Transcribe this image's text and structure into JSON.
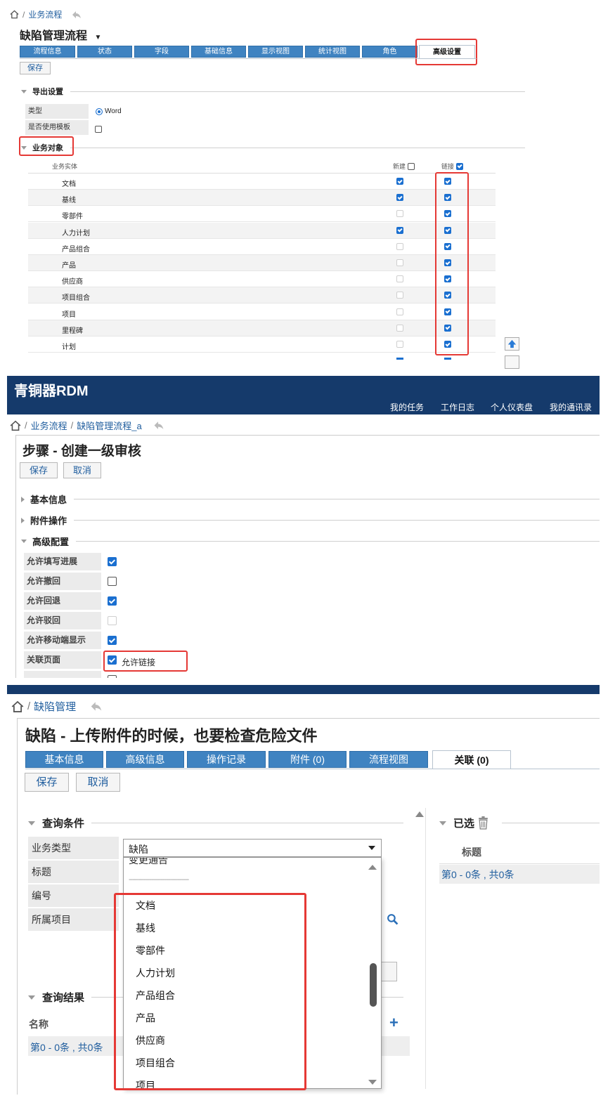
{
  "panel1": {
    "breadcrumb": [
      "业务流程"
    ],
    "title": "缺陷管理流程",
    "tabs": [
      "流程信息",
      "状态",
      "字段",
      "基础信息",
      "显示视图",
      "统计视图",
      "角色",
      "高级设置"
    ],
    "save_label": "保存",
    "export_section": "导出设置",
    "type_label": "类型",
    "type_value": "Word",
    "template_label": "是否使用模板",
    "business_section": "业务对象",
    "col_entity": "业务实体",
    "col_new": "新建",
    "col_link": "链接",
    "rows": [
      {
        "name": "文档",
        "new": "on",
        "link": "on"
      },
      {
        "name": "基线",
        "new": "on",
        "link": "on"
      },
      {
        "name": "零部件",
        "new": "dis",
        "link": "on"
      },
      {
        "name": "人力计划",
        "new": "on",
        "link": "on"
      },
      {
        "name": "产品组合",
        "new": "dis",
        "link": "on"
      },
      {
        "name": "产品",
        "new": "dis",
        "link": "on"
      },
      {
        "name": "供应商",
        "new": "dis",
        "link": "on"
      },
      {
        "name": "项目组合",
        "new": "dis",
        "link": "on"
      },
      {
        "name": "项目",
        "new": "dis",
        "link": "on"
      },
      {
        "name": "里程碑",
        "new": "dis",
        "link": "on"
      },
      {
        "name": "计划",
        "new": "dis",
        "link": "on"
      }
    ]
  },
  "panel2": {
    "brand": "青铜器RDM",
    "nav": [
      "我的任务",
      "工作日志",
      "个人仪表盘",
      "我的通讯录"
    ],
    "breadcrumb": [
      "业务流程",
      "缺陷管理流程_a"
    ],
    "title": "步骤 - 创建一级审核",
    "save_label": "保存",
    "cancel_label": "取消",
    "sections": [
      "基本信息",
      "附件操作",
      "高级配置"
    ],
    "options": [
      {
        "label": "允许填写进展",
        "state": "on"
      },
      {
        "label": "允许撤回",
        "state": "off"
      },
      {
        "label": "允许回退",
        "state": "on"
      },
      {
        "label": "允许驳回",
        "state": "dis"
      },
      {
        "label": "允许移动端显示",
        "state": "on"
      },
      {
        "label": "关联页面",
        "state": "on",
        "extra": "允许链接"
      }
    ]
  },
  "panel3": {
    "breadcrumb": [
      "缺陷管理"
    ],
    "title": "缺陷 - 上传附件的时候，也要检查危险文件",
    "tabs": [
      "基本信息",
      "高级信息",
      "操作记录",
      "附件 (0)",
      "流程视图",
      "关联 (0)"
    ],
    "save_label": "保存",
    "cancel_label": "取消",
    "query_section": "查询条件",
    "fields": [
      "业务类型",
      "标题",
      "编号",
      "所属项目"
    ],
    "select_value": "缺陷",
    "dropdown_partial": "变更通告",
    "dropdown_sep": "--------------------------------",
    "dropdown_items": [
      "文档",
      "基线",
      "零部件",
      "人力计划",
      "产品组合",
      "产品",
      "供应商",
      "项目组合",
      "项目"
    ],
    "result_section": "查询结果",
    "result_col": "名称",
    "result_pager": "第0 - 0条 , 共0条",
    "selected_section": "已选",
    "selected_col": "标题",
    "selected_pager": "第0 - 0条 , 共0条"
  },
  "colors": {
    "accent": "#3f83c1",
    "header_bg": "#153a6b",
    "highlight": "#e53935"
  }
}
